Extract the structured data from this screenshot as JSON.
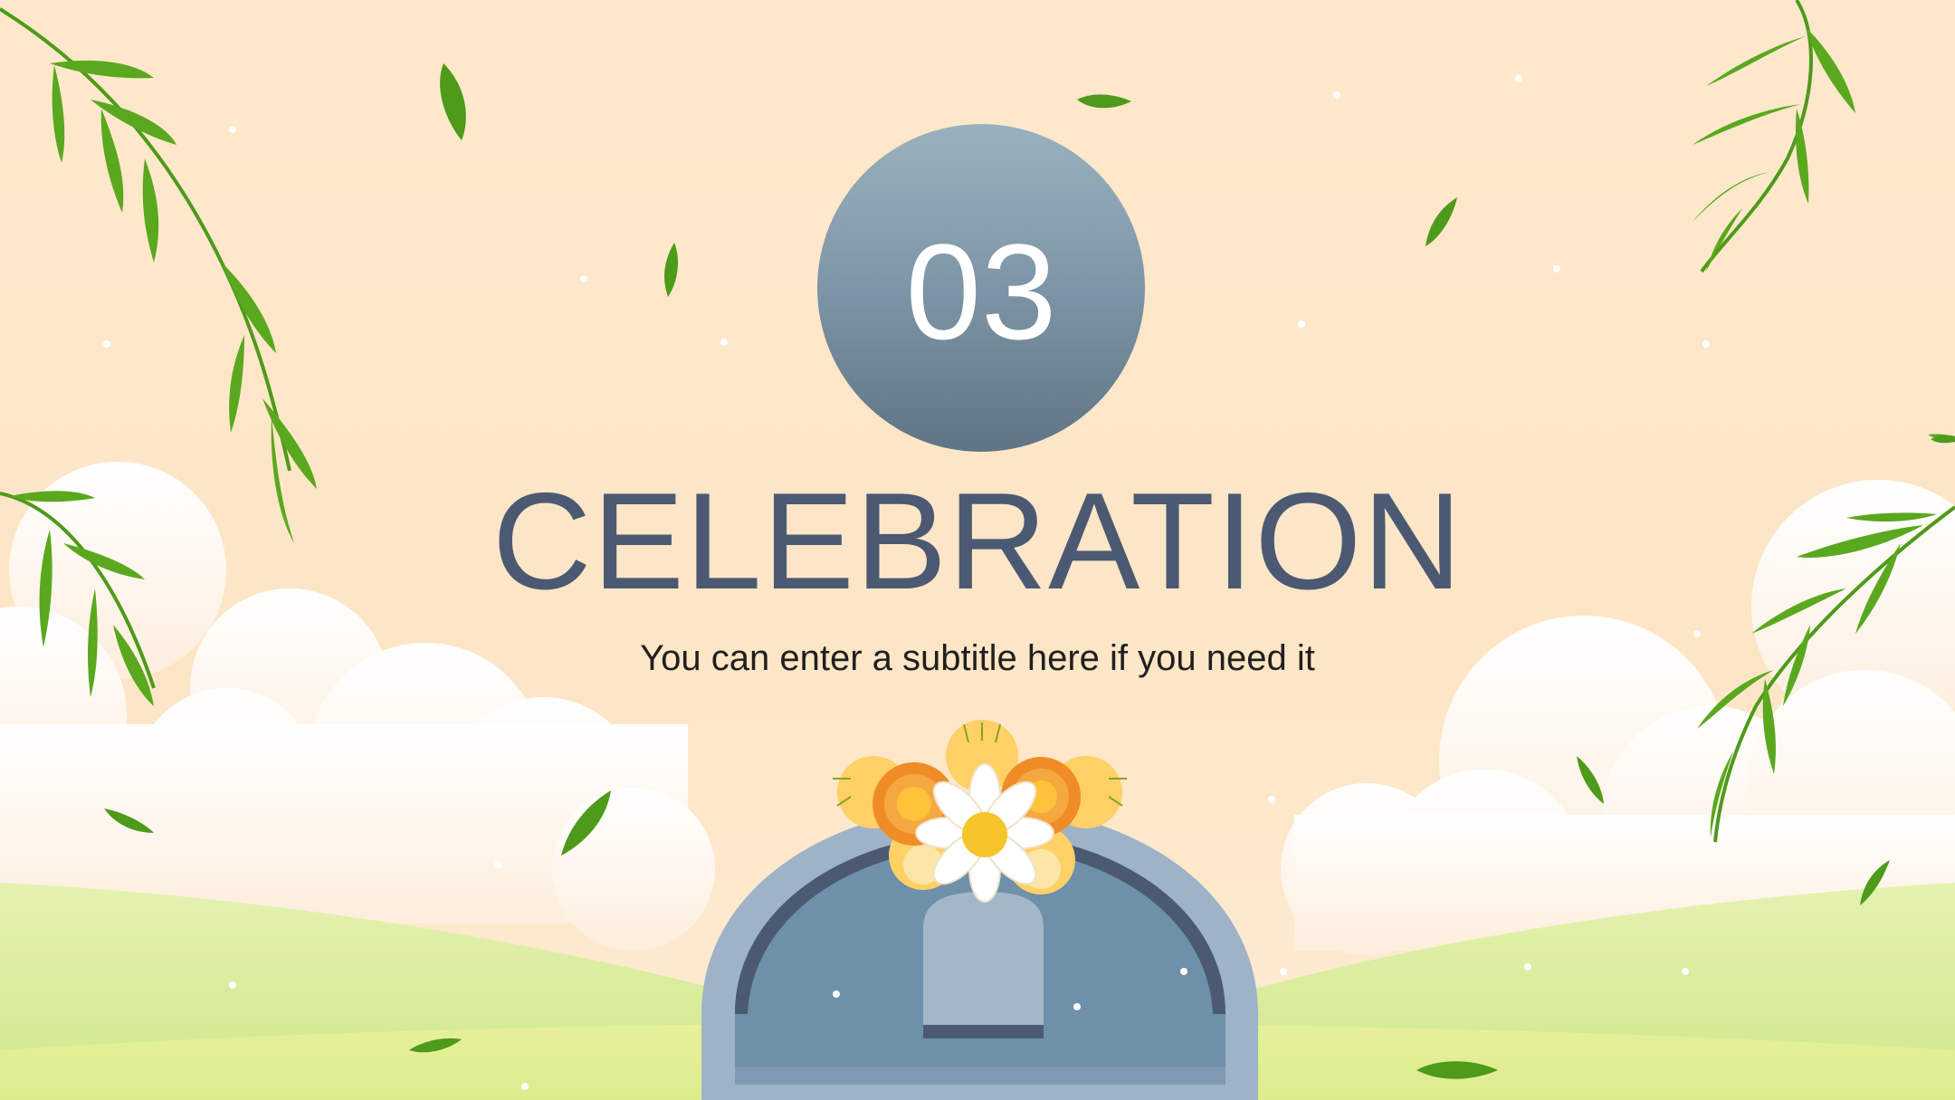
{
  "slide": {
    "section_number": "03",
    "title": "CELEBRATION",
    "subtitle": "You can enter a subtitle here if you need it"
  },
  "colors": {
    "sky": "#fde7c8",
    "badge_top": "#9ab1bf",
    "badge_bottom": "#5f7585",
    "title_text": "#4b5a72",
    "grass": "#d8ec93",
    "leaf_green": "#4e9a1a",
    "tomb_outer": "#9fb3c8",
    "tomb_inner": "#6e90a8"
  },
  "icons": [
    "willow-branch-icon",
    "leaf-icon",
    "cloud-icon",
    "flower-bouquet-icon",
    "tombstone-icon"
  ]
}
